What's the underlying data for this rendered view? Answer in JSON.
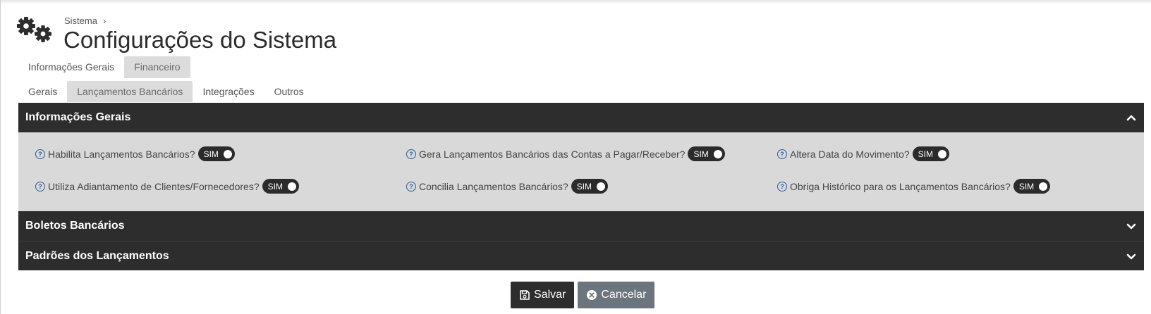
{
  "header": {
    "breadcrumb": "Sistema",
    "title": "Configurações do Sistema"
  },
  "tabs_primary": [
    {
      "label": "Informações Gerais",
      "active": false
    },
    {
      "label": "Financeiro",
      "active": true
    }
  ],
  "tabs_secondary": [
    {
      "label": "Gerais",
      "active": false
    },
    {
      "label": "Lançamentos Bancários",
      "active": true
    },
    {
      "label": "Integrações",
      "active": false
    },
    {
      "label": "Outros",
      "active": false
    }
  ],
  "sections": [
    {
      "title": "Informações Gerais",
      "expanded": true,
      "fields": [
        {
          "label": "Habilita Lançamentos Bancários?",
          "value": "SIM"
        },
        {
          "label": "Gera Lançamentos Bancários das Contas a Pagar/Receber?",
          "value": "SIM"
        },
        {
          "label": "Altera Data do Movimento?",
          "value": "SIM"
        },
        {
          "label": "Utiliza Adiantamento de Clientes/Fornecedores?",
          "value": "SIM"
        },
        {
          "label": "Concilia Lançamentos Bancários?",
          "value": "SIM"
        },
        {
          "label": "Obriga Histórico para os Lançamentos Bancários?",
          "value": "SIM"
        }
      ]
    },
    {
      "title": "Boletos Bancários",
      "expanded": false
    },
    {
      "title": "Padrões dos Lançamentos",
      "expanded": false
    }
  ],
  "actions": {
    "save_label": "Salvar",
    "cancel_label": "Cancelar"
  },
  "icons": {
    "header": "gears-icon",
    "help": "question-circle-icon",
    "save": "floppy-disk-icon",
    "cancel": "x-circle-icon"
  }
}
